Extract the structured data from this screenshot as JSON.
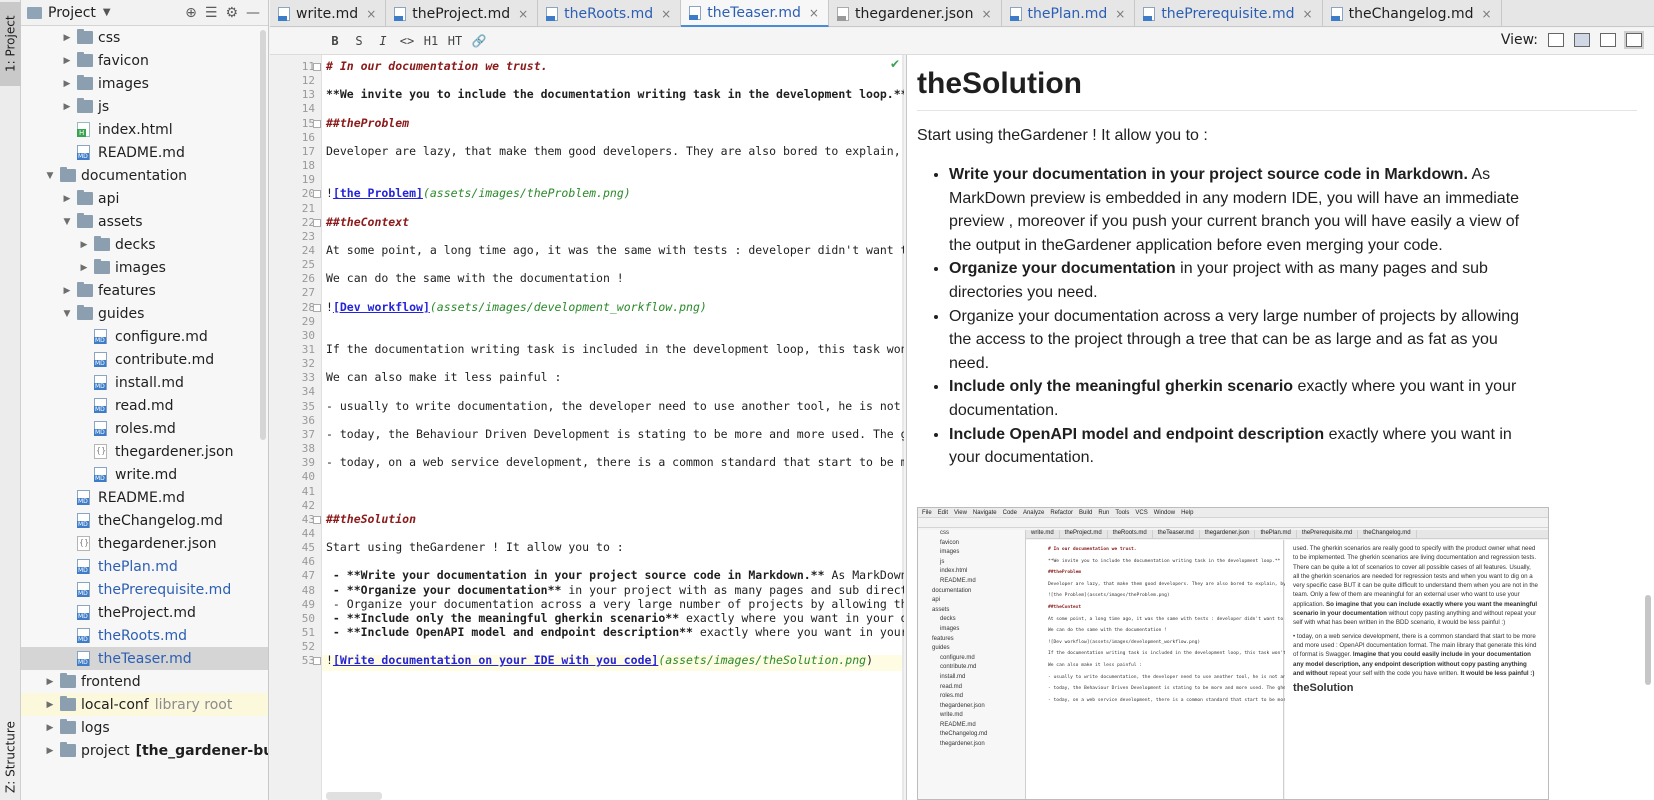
{
  "sidebar": {
    "project_tab": "1: Project",
    "structure_tab": "Z: Structure"
  },
  "project_panel": {
    "title": "Project",
    "tree": [
      {
        "label": "css",
        "type": "folder",
        "depth": 2,
        "arrow": "collapsed"
      },
      {
        "label": "favicon",
        "type": "folder",
        "depth": 2,
        "arrow": "collapsed"
      },
      {
        "label": "images",
        "type": "folder",
        "depth": 2,
        "arrow": "collapsed"
      },
      {
        "label": "js",
        "type": "folder",
        "depth": 2,
        "arrow": "collapsed"
      },
      {
        "label": "index.html",
        "type": "html",
        "depth": 2
      },
      {
        "label": "README.md",
        "type": "md",
        "depth": 2
      },
      {
        "label": "documentation",
        "type": "folder",
        "depth": 1,
        "arrow": "expanded"
      },
      {
        "label": "api",
        "type": "folder",
        "depth": 2,
        "arrow": "collapsed"
      },
      {
        "label": "assets",
        "type": "folder",
        "depth": 2,
        "arrow": "expanded"
      },
      {
        "label": "decks",
        "type": "folder",
        "depth": 3,
        "arrow": "collapsed"
      },
      {
        "label": "images",
        "type": "folder",
        "depth": 3,
        "arrow": "collapsed"
      },
      {
        "label": "features",
        "type": "folder",
        "depth": 2,
        "arrow": "collapsed"
      },
      {
        "label": "guides",
        "type": "folder",
        "depth": 2,
        "arrow": "expanded"
      },
      {
        "label": "configure.md",
        "type": "md",
        "depth": 3
      },
      {
        "label": "contribute.md",
        "type": "md",
        "depth": 3
      },
      {
        "label": "install.md",
        "type": "md",
        "depth": 3
      },
      {
        "label": "read.md",
        "type": "md",
        "depth": 3
      },
      {
        "label": "roles.md",
        "type": "md",
        "depth": 3
      },
      {
        "label": "thegardener.json",
        "type": "json",
        "depth": 3
      },
      {
        "label": "write.md",
        "type": "md",
        "depth": 3
      },
      {
        "label": "README.md",
        "type": "md",
        "depth": 2
      },
      {
        "label": "theChangelog.md",
        "type": "md",
        "depth": 2
      },
      {
        "label": "thegardener.json",
        "type": "json",
        "depth": 2
      },
      {
        "label": "thePlan.md",
        "type": "md",
        "depth": 2,
        "blue": true
      },
      {
        "label": "thePrerequisite.md",
        "type": "md",
        "depth": 2,
        "blue": true
      },
      {
        "label": "theProject.md",
        "type": "md",
        "depth": 2
      },
      {
        "label": "theRoots.md",
        "type": "md",
        "depth": 2,
        "blue": true
      },
      {
        "label": "theTeaser.md",
        "type": "md",
        "depth": 2,
        "blue": true,
        "selected": true
      },
      {
        "label": "frontend",
        "type": "folder",
        "depth": 1,
        "arrow": "collapsed"
      },
      {
        "label": "local-conf",
        "type": "folder",
        "depth": 1,
        "arrow": "collapsed",
        "suffix": "library root",
        "highlight": true
      },
      {
        "label": "logs",
        "type": "folder",
        "depth": 1,
        "arrow": "collapsed"
      },
      {
        "label": "project",
        "type": "folder",
        "depth": 1,
        "arrow": "collapsed",
        "suffix": "[the_gardener-build]",
        "suffix_bold": true
      }
    ]
  },
  "tabs": [
    {
      "label": "write.md",
      "icon": "md",
      "blue": false
    },
    {
      "label": "theProject.md",
      "icon": "md",
      "blue": false
    },
    {
      "label": "theRoots.md",
      "icon": "md",
      "blue": true
    },
    {
      "label": "theTeaser.md",
      "icon": "md",
      "blue": true,
      "active": true
    },
    {
      "label": "thegardener.json",
      "icon": "json",
      "blue": false
    },
    {
      "label": "thePlan.md",
      "icon": "md",
      "blue": true
    },
    {
      "label": "thePrerequisite.md",
      "icon": "md",
      "blue": true
    },
    {
      "label": "theChangelog.md",
      "icon": "md",
      "blue": false
    }
  ],
  "md_toolbar": {
    "buttons": [
      "B",
      "S",
      "I",
      "<>",
      "H1",
      "HT",
      "🔗"
    ],
    "view_label": "View:"
  },
  "editor": {
    "line_numbers": [
      "11",
      "12",
      "13",
      "14",
      "15",
      "16",
      "17",
      "18",
      "19",
      "20",
      "21",
      "22",
      "23",
      "24",
      "25",
      "26",
      "27",
      "28",
      "29",
      "30",
      "31",
      "32",
      "33",
      "34",
      "35",
      "36",
      "37",
      "38",
      "39",
      "40",
      "41",
      "42",
      "43",
      "44",
      "45",
      "46",
      "47",
      "48",
      "49",
      "50",
      "51",
      "52",
      "53"
    ],
    "lines": [
      {
        "n": 11,
        "segments": [
          {
            "t": "# In our documentation we trust.",
            "c": "h"
          }
        ]
      },
      {
        "n": 13,
        "segments": [
          {
            "t": "**We invite you to include the documentation writing task in the development loop.**",
            "c": "b"
          },
          {
            "t": " Yo",
            "c": ""
          }
        ]
      },
      {
        "n": 15,
        "segments": [
          {
            "t": "##theProblem",
            "c": "h"
          }
        ]
      },
      {
        "n": 17,
        "segments": [
          {
            "t": "Developer are lazy, that make them good developers. They are also bored to explain, by",
            "c": ""
          }
        ]
      },
      {
        "n": 20,
        "segments": [
          {
            "t": "!",
            "c": ""
          },
          {
            "t": "[the Problem]",
            "c": "lnk"
          },
          {
            "t": "(assets/images/theProblem.png)",
            "c": "url"
          }
        ]
      },
      {
        "n": 22,
        "segments": [
          {
            "t": "##theContext",
            "c": "h"
          }
        ]
      },
      {
        "n": 24,
        "segments": [
          {
            "t": "At some point, a long time ago, it was the same with tests : developer didn't want to w",
            "c": ""
          }
        ]
      },
      {
        "n": 26,
        "segments": [
          {
            "t": "We can do the same with the documentation !",
            "c": ""
          }
        ]
      },
      {
        "n": 28,
        "segments": [
          {
            "t": "!",
            "c": ""
          },
          {
            "t": "[Dev workflow]",
            "c": "lnk"
          },
          {
            "t": "(assets/images/development_workflow.png)",
            "c": "url"
          }
        ]
      },
      {
        "n": 31,
        "segments": [
          {
            "t": "If the documentation writing task is included in the development loop, this task won't",
            "c": ""
          }
        ]
      },
      {
        "n": 33,
        "segments": [
          {
            "t": "We can also make it less painful :",
            "c": ""
          }
        ]
      },
      {
        "n": 35,
        "segments": [
          {
            "t": "- usually to write documentation, the developer need to use another tool, he is not any",
            "c": ""
          }
        ]
      },
      {
        "n": 37,
        "segments": [
          {
            "t": "- today, the Behaviour Driven Development is stating to be more and more used. The gher",
            "c": ""
          }
        ]
      },
      {
        "n": 39,
        "segments": [
          {
            "t": "- today, on a web service development, there is a common standard that start to be more",
            "c": ""
          }
        ]
      },
      {
        "n": 43,
        "segments": [
          {
            "t": "##theSolution",
            "c": "h"
          }
        ]
      },
      {
        "n": 45,
        "segments": [
          {
            "t": "Start using theGardener ! It allow you to :",
            "c": ""
          }
        ]
      },
      {
        "n": 47,
        "segments": [
          {
            "t": " - ",
            "c": "b"
          },
          {
            "t": "**Write your documentation in your project source code in Markdown.**",
            "c": "b"
          },
          {
            "t": " As MarkDown pr",
            "c": ""
          }
        ]
      },
      {
        "n": 48,
        "segments": [
          {
            "t": " - ",
            "c": "b"
          },
          {
            "t": "**Organize your documentation**",
            "c": "b"
          },
          {
            "t": " in your project with as many pages and sub directori",
            "c": ""
          }
        ]
      },
      {
        "n": 49,
        "segments": [
          {
            "t": " - Organize your documentation across a very large number of projects by allowing the a",
            "c": ""
          }
        ]
      },
      {
        "n": 50,
        "segments": [
          {
            "t": " - ",
            "c": "b"
          },
          {
            "t": "**Include only the meaningful gherkin scenario**",
            "c": "b"
          },
          {
            "t": " exactly where you want in your docu",
            "c": ""
          }
        ]
      },
      {
        "n": 51,
        "segments": [
          {
            "t": " - ",
            "c": "b"
          },
          {
            "t": "**Include OpenAPI model and endpoint description**",
            "c": "b"
          },
          {
            "t": " exactly where you want in your do",
            "c": ""
          }
        ]
      },
      {
        "n": 53,
        "segments": [
          {
            "t": "!",
            "c": ""
          },
          {
            "t": "[Write documentation on your IDE with you code]",
            "c": "lnk"
          },
          {
            "t": "(assets/images/theSolution.png",
            "c": "url"
          },
          {
            "t": ")",
            "c": ""
          }
        ]
      }
    ]
  },
  "preview": {
    "title": "theSolution",
    "intro": "Start using theGardener ! It allow you to :",
    "items": [
      {
        "strong": "Write your documentation in your project source code in Markdown.",
        "rest": " As MarkDown preview is embedded in any modern IDE, you will have an immediate preview , moreover if you push your current branch you will have easily a view of the output in theGardener application before even merging your code."
      },
      {
        "strong": "Organize your documentation",
        "rest": " in your project with as many pages and sub directories you need."
      },
      {
        "strong": "",
        "rest": "Organize your documentation across a very large number of projects by allowing the access to the project through a tree that can be as large and as fat as you need."
      },
      {
        "strong": "Include only the meaningful gherkin scenario",
        "rest": " exactly where you want in your documentation."
      },
      {
        "strong": "Include OpenAPI model and endpoint description",
        "rest": " exactly where you want in your documentation."
      }
    ],
    "thumbnail": {
      "menu": [
        "File",
        "Edit",
        "View",
        "Navigate",
        "Code",
        "Analyze",
        "Refactor",
        "Build",
        "Run",
        "Tools",
        "VCS",
        "Window",
        "Help"
      ],
      "tree": [
        "css",
        "favicon",
        "images",
        "js",
        "index.html",
        "README.md",
        "documentation",
        "api",
        "assets",
        "decks",
        "images",
        "features",
        "guides",
        "configure.md",
        "contribute.md",
        "install.md",
        "read.md",
        "roles.md",
        "thegardener.json",
        "write.md",
        "README.md",
        "theChangelog.md",
        "thegardener.json"
      ],
      "tabs": [
        "write.md",
        "theProject.md",
        "theRoots.md",
        "theTeaser.md",
        "thegardener.json",
        "thePlan.md",
        "thePrerequisite.md",
        "theChangelog.md"
      ],
      "code": [
        "# In our documentation we trust.",
        "**We invite you to include the documentation writing task in the development loop.**",
        "##theProblem",
        "Developer are lazy, that make them good developers. They are also bored to explain, by",
        "![the Problem](assets/images/theProblem.png)",
        "##theContext",
        "At some point, a long time ago, it was the same with tests : developer didn't want to w",
        "We can do the same with the documentation !",
        "![Dev workflow](assets/images/development_workflow.png)",
        "If the documentation writing task is included in the development loop, this task won't",
        "We can also make it less painful :",
        "- usually to write documentation, the developer need to use another tool, he is not any",
        "- today, the Behaviour Driven Development is stating to be more and more used. The gher",
        "- today, on a web service development, there is a common standard that start to be more"
      ],
      "prev_p1": "used. The gherkin scenarios are really good to specify with the product owner what need to be implemented. The gherkin scenarios are living documentation and regression tests. There can be quite a lot of scenarios to cover all possible cases of all features. Usually, all the gherkin scenarios are needed for regression tests and when you want to dig on a very specific case BUT it can be quite difficult to understand them when you are not in the team. Only a few of them are meaningful for an external user who want to use your application.",
      "prev_p1_bold": "So imagine that you can include exactly where you want the meaningful scenario in your documentation",
      "prev_p1_end": "without copy pasting anything and without repeat your self with what has been written in the BDD scenario, it would be less painful :)",
      "prev_p2": "today, on a web service development, there is a common standard that start to be more and more used : OpenAPI documentation format. The main library that generate this kind of format is Swagger.",
      "prev_p2_bold": "Imagine that you could easily include in your documentation any model description, any endpoint description without copy pasting anything and without",
      "prev_p2_end": "repeat your self with the code you have written.",
      "prev_p2_bold2": "It would be less painful :)",
      "prev_heading": "theSolution"
    }
  }
}
